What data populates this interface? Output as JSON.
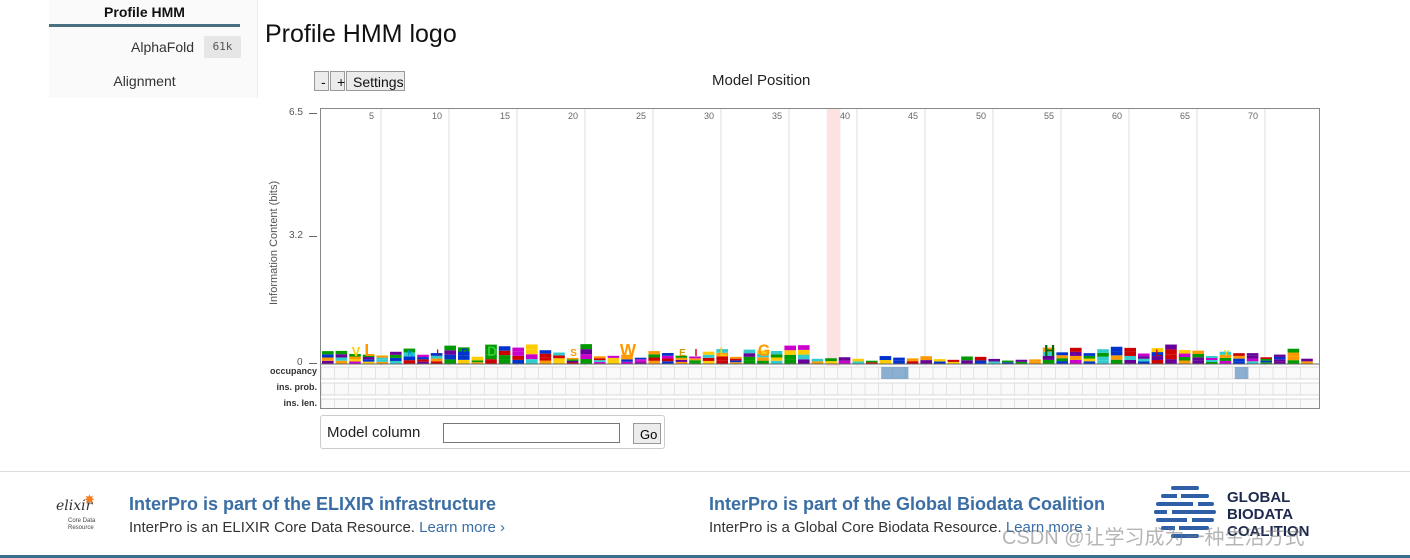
{
  "sidebar": {
    "tabs": [
      {
        "label": "Profile HMM",
        "active": true
      },
      {
        "label": "AlphaFold",
        "badge": "61k"
      },
      {
        "label": "Alignment"
      }
    ]
  },
  "page": {
    "title": "Profile HMM logo"
  },
  "controls": {
    "minus": "-",
    "plus": "+",
    "settings": "Settings"
  },
  "logo": {
    "model_position_label": "Model Position",
    "y_axis_label": "Information Content (bits)",
    "y_ticks": [
      "6.5",
      "3.2",
      "0"
    ],
    "x_ticks": [
      "5",
      "10",
      "15",
      "20",
      "25",
      "30",
      "35",
      "40",
      "45",
      "50",
      "55",
      "60",
      "65",
      "70"
    ],
    "row_labels": [
      "occupancy",
      "ins. prob.",
      "ins. len."
    ],
    "visible_letters": [
      "V",
      "L",
      "K",
      "I",
      "P",
      "D",
      "S",
      "W",
      "E",
      "I",
      "L",
      "G",
      "H",
      "Y",
      "L",
      "E",
      "Y",
      "E",
      "V"
    ],
    "highlight_column": 39
  },
  "model_column": {
    "label": "Model column",
    "value": "",
    "go": "Go"
  },
  "footer": {
    "elixir": {
      "title": "InterPro is part of the ELIXIR infrastructure",
      "text": "InterPro is an ELIXIR Core Data Resource.",
      "link": "Learn more ›",
      "logo_text": "elixir",
      "logo_sub": "Core Data Resource"
    },
    "gbc": {
      "title": "InterPro is part of the Global Biodata Coalition",
      "text": "InterPro is a Global Core Biodata Resource.",
      "link": "Learn more ›",
      "logo_lines": [
        "GLOBAL",
        "BIODATA",
        "COALITION"
      ]
    },
    "watermark": "CSDN @让学习成为一种生活方式"
  },
  "colors": {
    "accent": "#3a6ea5",
    "tab_underline": "#4a6f80",
    "highlight": "#fde2e2"
  }
}
